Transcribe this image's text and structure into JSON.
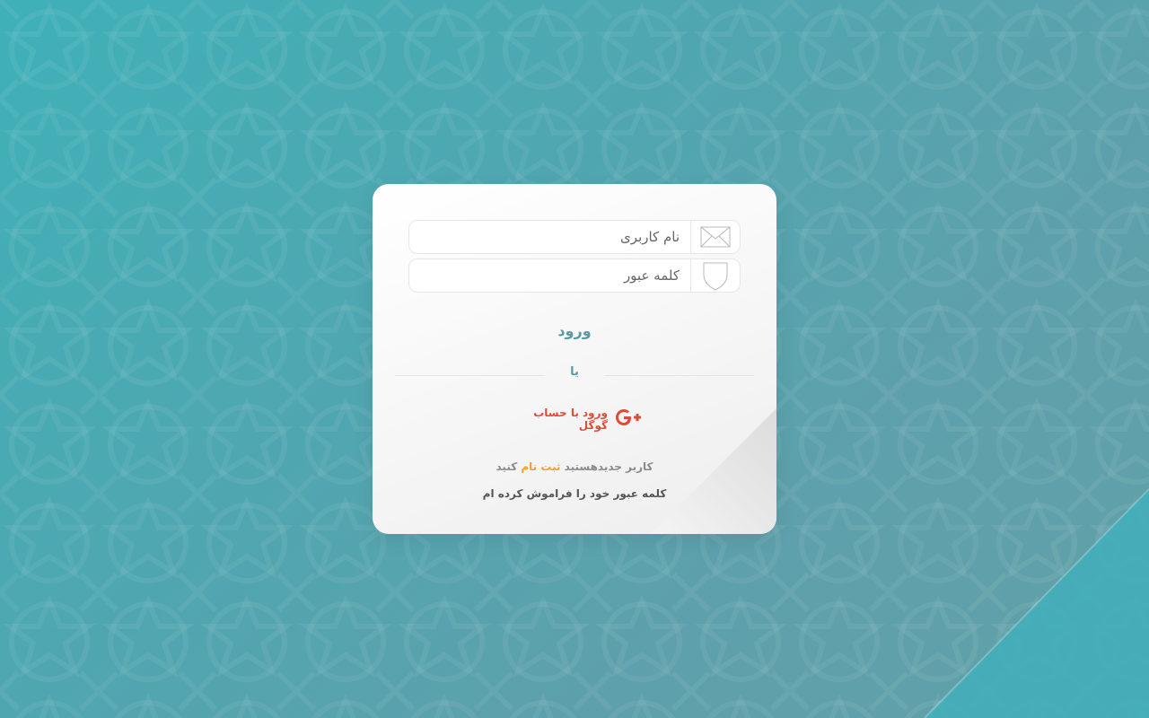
{
  "login_form": {
    "username_placeholder": "نام کاربری",
    "password_placeholder": "کلمه عبور",
    "submit_label": "ورود",
    "or_text": "یا",
    "google_login_label": "ورود با حساب گوگل",
    "signup_prefix": "کاربر جدیدهستید",
    "signup_link": "ثبت نام",
    "signup_suffix": "کنید",
    "forgot_password": "کلمه عبور خود را فراموش کرده ام"
  },
  "icons": {
    "username": "envelope-icon",
    "password": "shield-icon",
    "google": "google-plus-icon"
  },
  "colors": {
    "background_start": "#3fb0b8",
    "background_end": "#62a0a8",
    "accent": "#5a9aa6",
    "google_red": "#dd4b39",
    "signup_orange": "#f0a030"
  }
}
